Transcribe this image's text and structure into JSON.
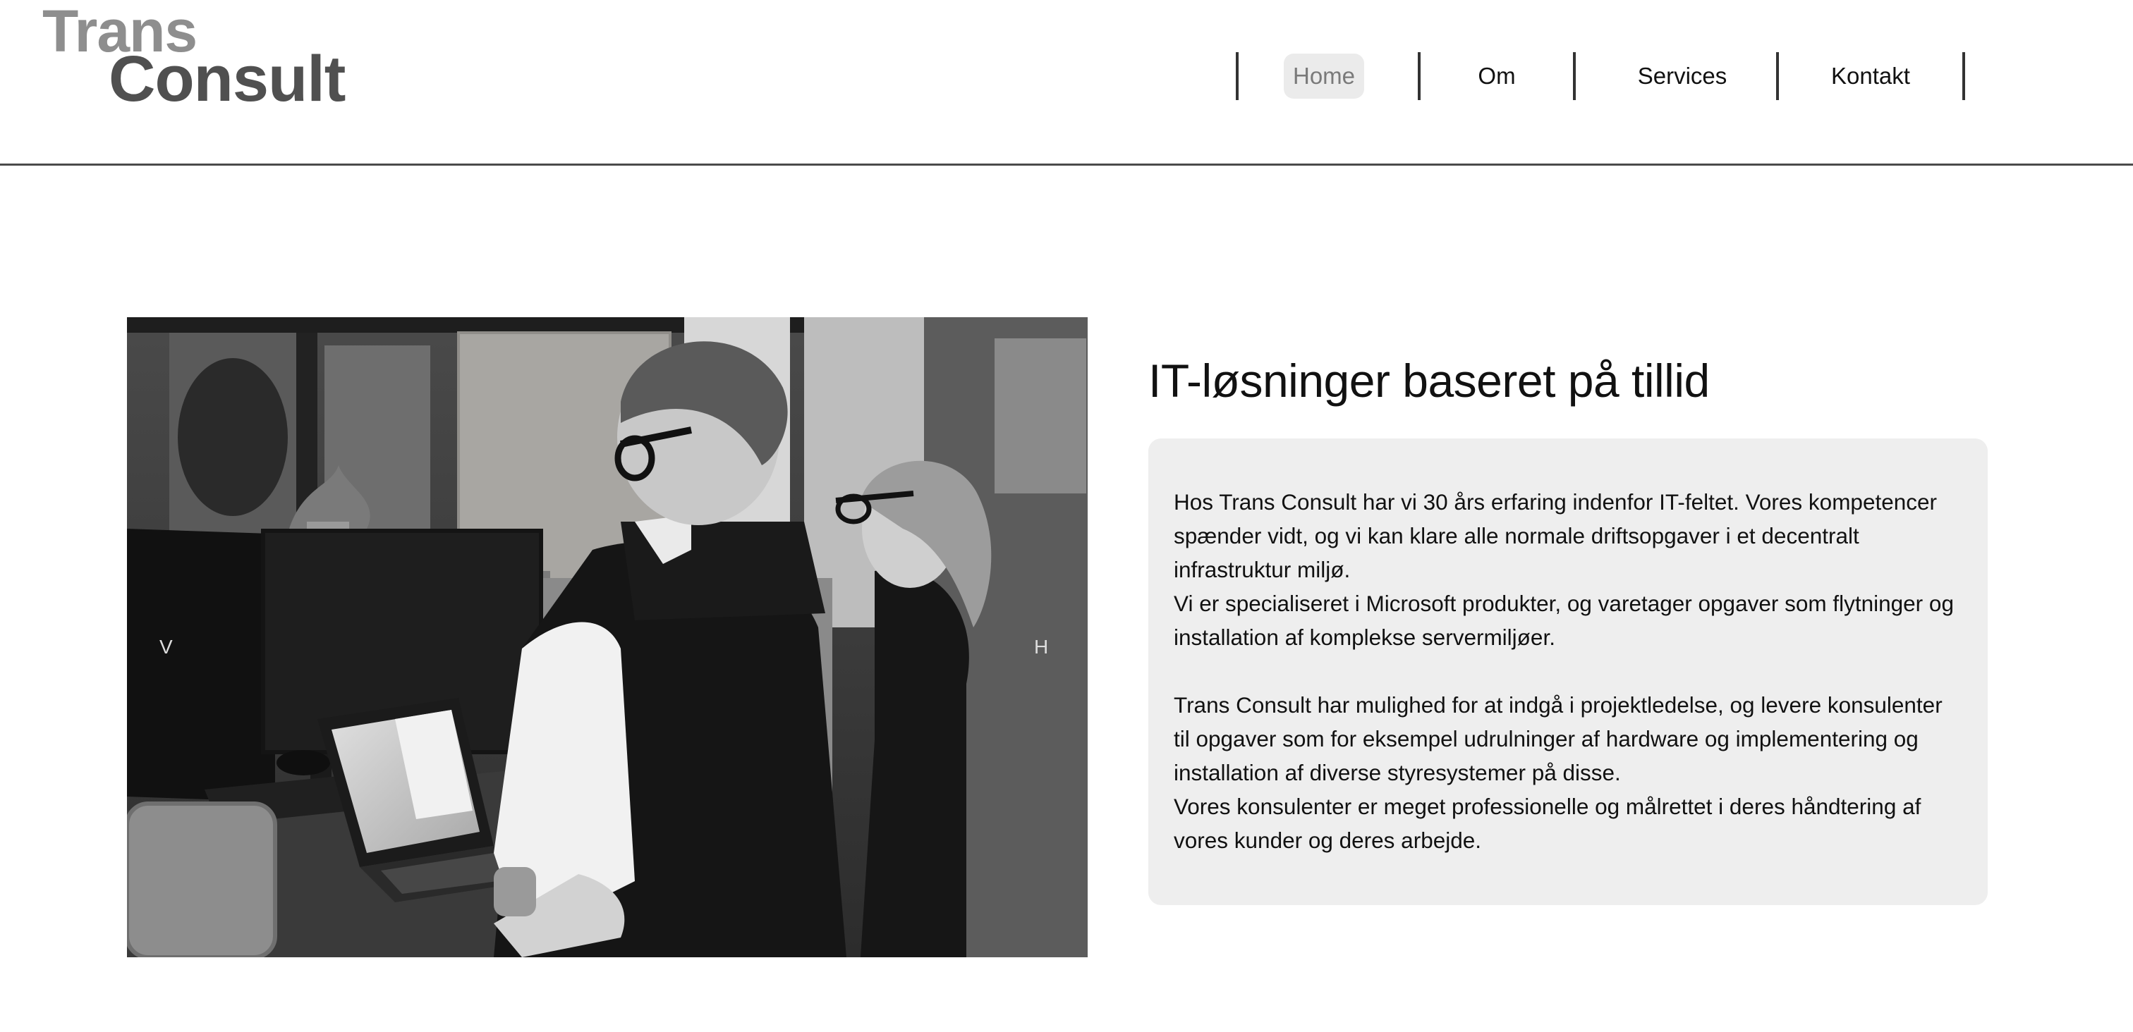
{
  "brand": {
    "line1": "Trans",
    "line2": "Consult"
  },
  "nav": {
    "items": [
      {
        "label": "Home",
        "active": true
      },
      {
        "label": "Om",
        "active": false
      },
      {
        "label": "Services",
        "active": false
      },
      {
        "label": "Kontakt",
        "active": false
      }
    ]
  },
  "slider": {
    "prev_label": "V",
    "next_label": "H"
  },
  "main": {
    "title": "IT-løsninger baseret på tillid",
    "paragraphs": [
      "Hos Trans Consult har vi 30 års erfaring indenfor IT-feltet. Vores kompetencer spænder vidt, og vi kan klare alle normale driftsopgaver i et decentralt infrastruktur miljø.",
      "Vi er specialiseret i Microsoft produkter, og varetager opgaver som flytninger og installation af komplekse servermiljøer.",
      "Trans Consult har mulighed for at indgå i projektledelse, og levere konsulenter til opgaver som for eksempel udrulninger af hardware og implementering og installation af diverse styresystemer på disse.",
      "Vores konsulenter er meget professionelle og målrettet i deres håndtering af vores kunder og deres arbejde."
    ]
  },
  "colors": {
    "logo_light": "#8e8e8e",
    "logo_dark": "#505050",
    "active_nav_bg": "#ebebeb",
    "textbox_bg": "#eeeeee"
  }
}
